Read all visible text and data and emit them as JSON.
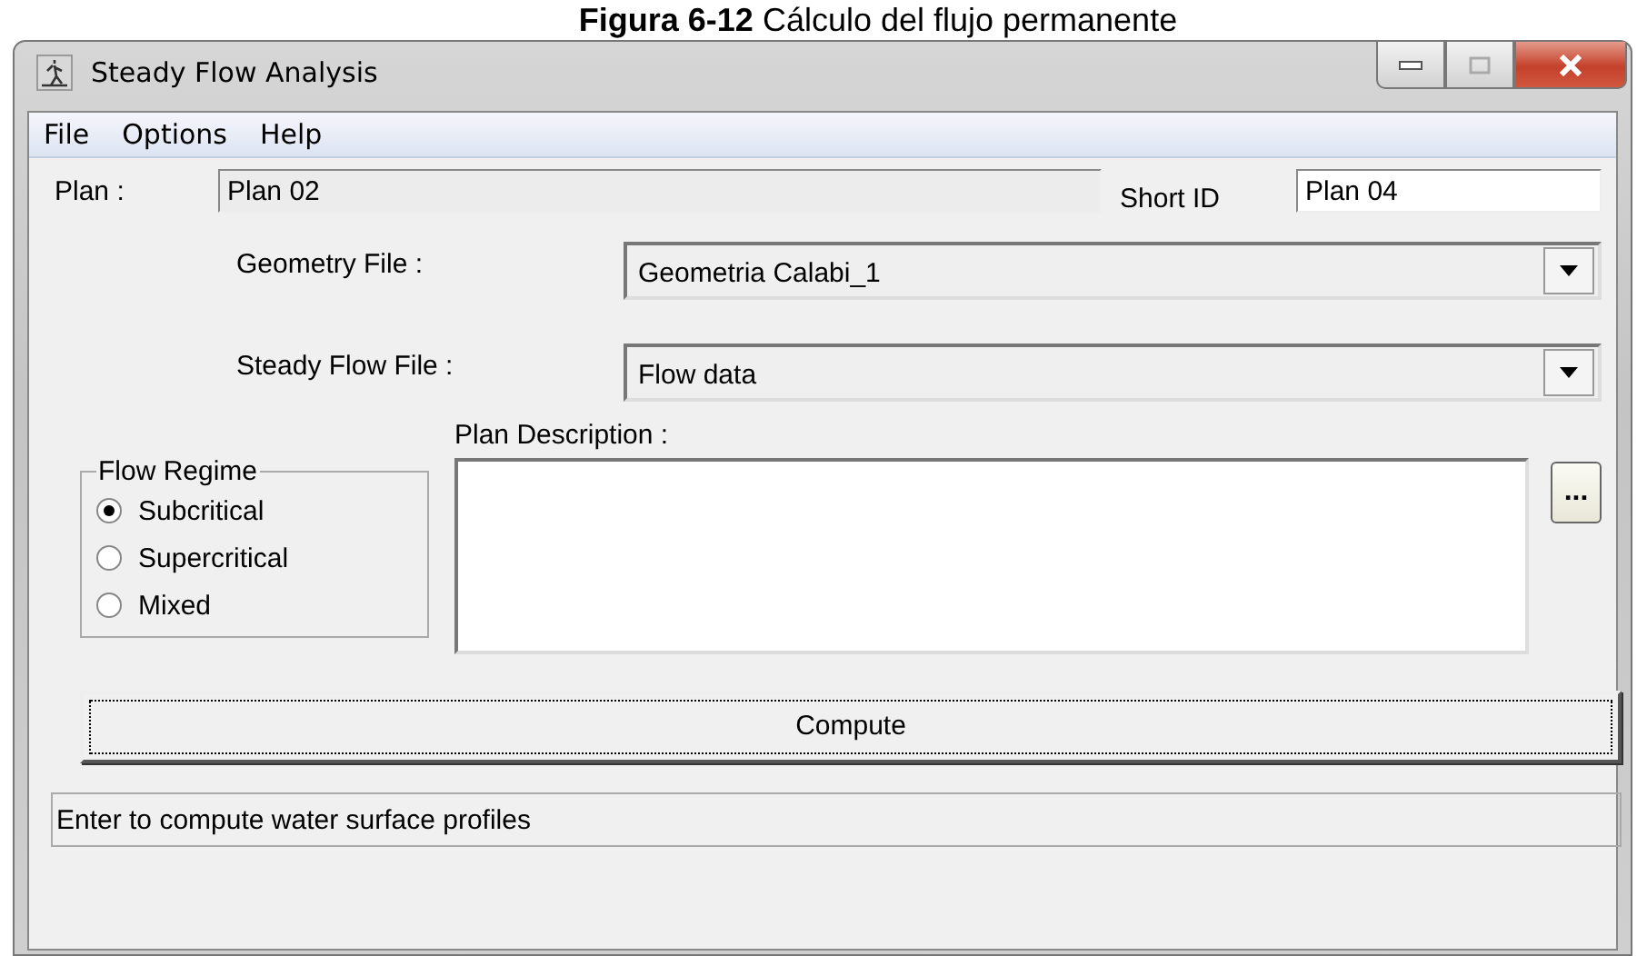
{
  "caption": "**Figura 6-12** Cálculo del flujo permanente",
  "window": {
    "title": "Steady Flow Analysis"
  },
  "menu": [
    "File",
    "Options",
    "Help"
  ],
  "plan": {
    "label": "Plan :",
    "value": "Plan 02"
  },
  "short_id": {
    "label": "Short ID",
    "value": "Plan 04"
  },
  "geometry_file": {
    "label": "Geometry File :",
    "value": "Geometria Calabi_1"
  },
  "steady_flow_file": {
    "label": "Steady Flow File :",
    "value": "Flow data"
  },
  "flow_regime": {
    "title": "Flow Regime",
    "options": [
      {
        "label": "Subcritical",
        "selected": true
      },
      {
        "label": "Supercritical",
        "selected": false
      },
      {
        "label": "Mixed",
        "selected": false
      }
    ]
  },
  "plan_description": {
    "label": "Plan Description :",
    "browse_button": "..."
  },
  "compute_button": "Compute",
  "status_bar": "Enter to compute water surface profiles"
}
